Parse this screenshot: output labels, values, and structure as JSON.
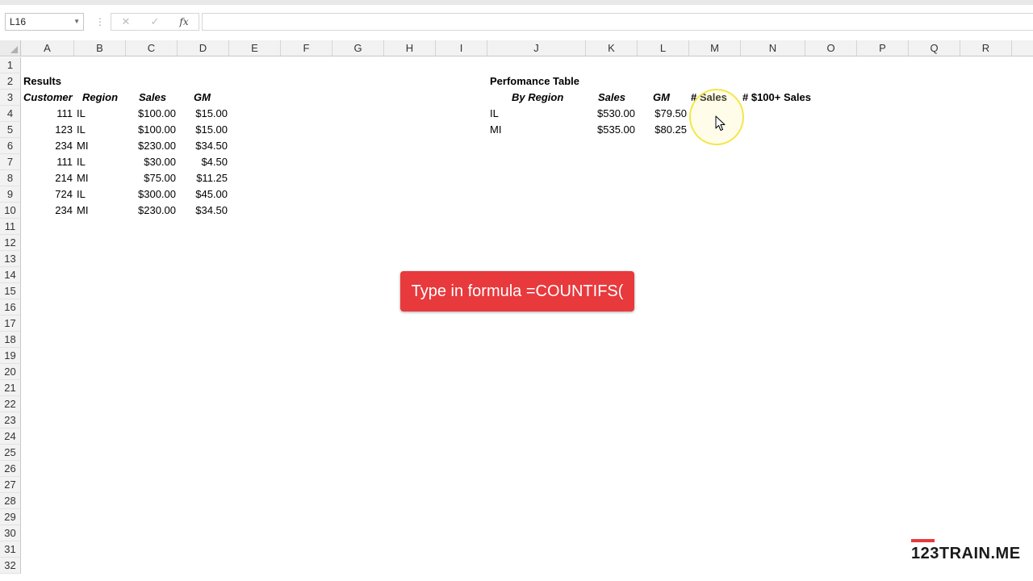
{
  "formula_bar": {
    "name_box": "L16",
    "formula": "",
    "cancel_icon": "✕",
    "enter_icon": "✓",
    "fx_label": "fx"
  },
  "columns": [
    "A",
    "B",
    "C",
    "D",
    "E",
    "F",
    "G",
    "H",
    "I",
    "J",
    "K",
    "L",
    "M",
    "N",
    "O",
    "P",
    "Q",
    "R"
  ],
  "rows": [
    "1",
    "2",
    "3",
    "4",
    "5",
    "6",
    "7",
    "8",
    "9",
    "10",
    "11",
    "12",
    "13",
    "14",
    "15",
    "16",
    "17",
    "18",
    "19",
    "20",
    "21",
    "22",
    "23",
    "24",
    "25",
    "26",
    "27",
    "28",
    "29",
    "30",
    "31",
    "32"
  ],
  "results": {
    "title": "Results",
    "headers": {
      "customer": "Customer",
      "region": "Region",
      "sales": "Sales",
      "gm": "GM"
    },
    "rows": [
      {
        "customer": "111",
        "region": "IL",
        "sales": "$100.00",
        "gm": "$15.00"
      },
      {
        "customer": "123",
        "region": "IL",
        "sales": "$100.00",
        "gm": "$15.00"
      },
      {
        "customer": "234",
        "region": "MI",
        "sales": "$230.00",
        "gm": "$34.50"
      },
      {
        "customer": "111",
        "region": "IL",
        "sales": "$30.00",
        "gm": "$4.50"
      },
      {
        "customer": "214",
        "region": "MI",
        "sales": "$75.00",
        "gm": "$11.25"
      },
      {
        "customer": "724",
        "region": "IL",
        "sales": "$300.00",
        "gm": "$45.00"
      },
      {
        "customer": "234",
        "region": "MI",
        "sales": "$230.00",
        "gm": "$34.50"
      }
    ]
  },
  "performance": {
    "title": "Perfomance Table",
    "headers": {
      "by_region": "By Region",
      "sales": "Sales",
      "gm": "GM",
      "num_sales": "# Sales",
      "num_100_sales": "# $100+ Sales"
    },
    "rows": [
      {
        "region": "IL",
        "sales": "$530.00",
        "gm": "$79.50"
      },
      {
        "region": "MI",
        "sales": "$535.00",
        "gm": "$80.25"
      }
    ]
  },
  "instruction": "Type in formula =COUNTIFS(",
  "brand": "123TRAIN.ME",
  "colors": {
    "accent": "#e8393d",
    "highlight": "#f4e64a"
  },
  "icons": {
    "cursor": "arrow-cursor-icon",
    "dropdown": "chevron-down-icon"
  }
}
